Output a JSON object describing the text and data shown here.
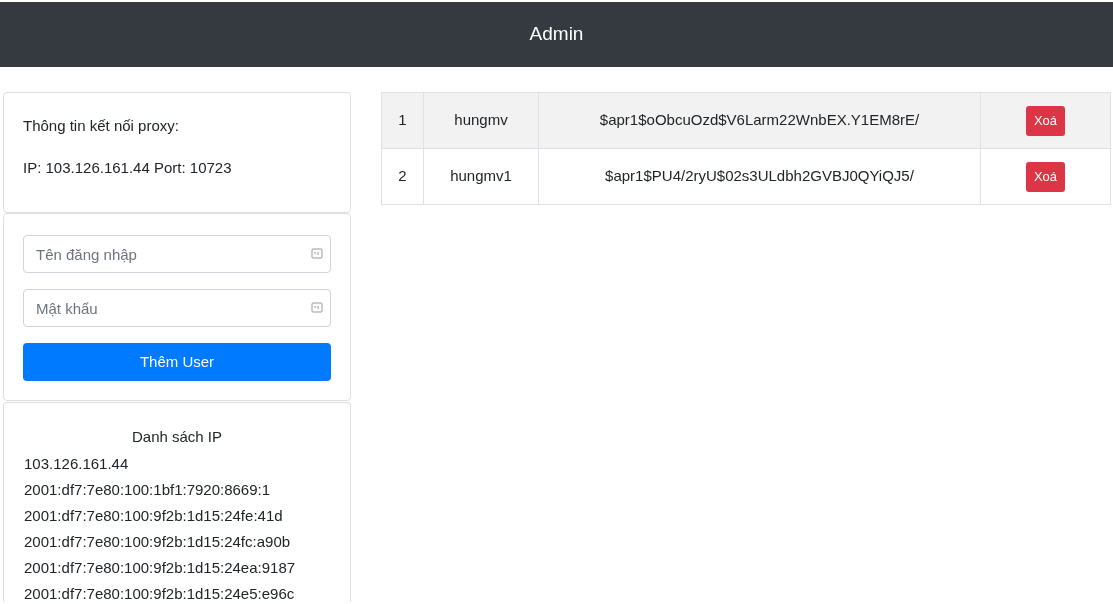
{
  "header": {
    "title": "Admin"
  },
  "proxy_info": {
    "title": "Thông tin kết nối proxy:",
    "details": "IP: 103.126.161.44 Port: 10723"
  },
  "add_user_form": {
    "fields": [
      {
        "placeholder": "Tên đăng nhập"
      },
      {
        "placeholder": "Mật khẩu"
      }
    ],
    "button": "Thêm User"
  },
  "ip_list": {
    "title": "Danh sách IP",
    "items": [
      "103.126.161.44",
      "2001:df7:7e80:100:1bf1:7920:8669:1",
      "2001:df7:7e80:100:9f2b:1d15:24fe:41d",
      "2001:df7:7e80:100:9f2b:1d15:24fc:a90b",
      "2001:df7:7e80:100:9f2b:1d15:24ea:9187",
      "2001:df7:7e80:100:9f2b:1d15:24e5:e96c"
    ]
  },
  "users_table": {
    "rows": [
      {
        "index": "1",
        "username": "hungmv",
        "password_hash": "$apr1$oObcuOzd$V6Larm22WnbEX.Y1EM8rE/",
        "action": "Xoá"
      },
      {
        "index": "2",
        "username": "hungmv1",
        "password_hash": "$apr1$PU4/2ryU$02s3ULdbh2GVBJ0QYiQJ5/",
        "action": "Xoá"
      }
    ]
  }
}
